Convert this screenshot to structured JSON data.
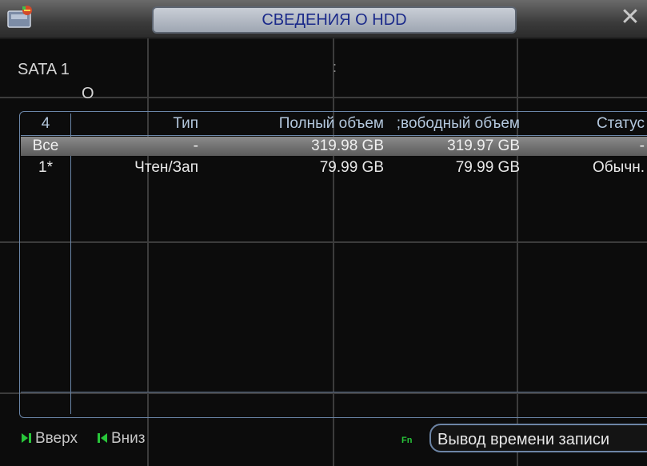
{
  "window": {
    "title": "СВЕДЕНИЯ О HDD",
    "close_glyph": "✕",
    "close_icon": "close-icon",
    "app_icon": "hdd-icon"
  },
  "disk": {
    "label": "SATA  1",
    "sub_label": "O",
    "separator": ":"
  },
  "table": {
    "columns": {
      "index": "4",
      "type": "Тип",
      "total": "Полный объем",
      "free": ";вободный объем",
      "status": "Статус"
    },
    "rows": [
      {
        "index": "Все",
        "type": "-",
        "total": "319.98 GB",
        "free": "319.97 GB",
        "status": "-"
      },
      {
        "index": "1*",
        "type": "Чтен/Зап",
        "total": "79.99 GB",
        "free": "79.99 GB",
        "status": "Обычн."
      }
    ]
  },
  "footer": {
    "up_label": "Вверх",
    "down_label": "Вниз",
    "fn_label": "Fn",
    "record_time_button": "Вывод времени записи"
  },
  "colors": {
    "accent": "#6b86a8",
    "title_text": "#1b2a8a",
    "selected_row": "#7a7a7a",
    "pager_green": "#28c53a"
  }
}
